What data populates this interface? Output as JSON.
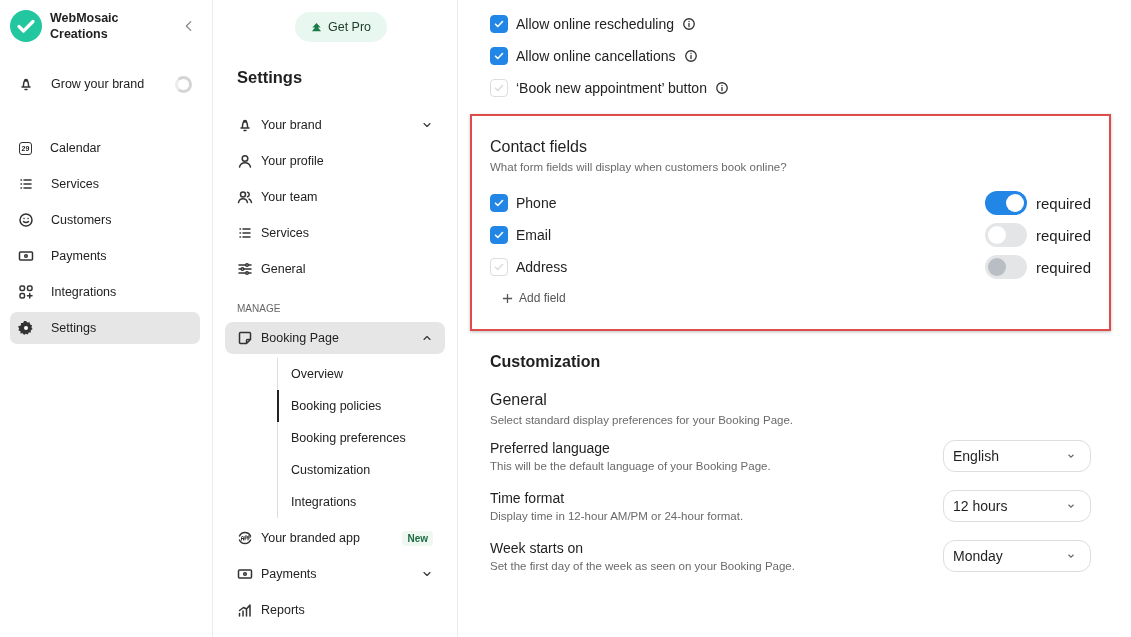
{
  "brand": {
    "name": "WebMosaic Creations"
  },
  "sidebar": {
    "promo": {
      "label": "Grow your brand"
    },
    "items": [
      {
        "label": "Calendar",
        "icon_text": "29",
        "selected": false
      },
      {
        "label": "Services",
        "selected": false
      },
      {
        "label": "Customers",
        "selected": false
      },
      {
        "label": "Payments",
        "selected": false
      },
      {
        "label": "Integrations",
        "selected": false
      },
      {
        "label": "Settings",
        "selected": true
      }
    ]
  },
  "settings_nav": {
    "get_pro": "Get Pro",
    "title": "Settings",
    "items": [
      {
        "label": "Your brand",
        "expanded": false
      },
      {
        "label": "Your profile"
      },
      {
        "label": "Your team"
      },
      {
        "label": "Services"
      },
      {
        "label": "General"
      }
    ],
    "section": "MANAGE",
    "manage": [
      {
        "label": "Booking Page",
        "selected": true,
        "expanded": true,
        "children": [
          {
            "label": "Overview",
            "selected": false
          },
          {
            "label": "Booking policies",
            "selected": true
          },
          {
            "label": "Booking preferences",
            "selected": false
          },
          {
            "label": "Customization",
            "selected": false
          },
          {
            "label": "Integrations",
            "selected": false
          }
        ]
      },
      {
        "label": "Your branded app",
        "badge": "New"
      },
      {
        "label": "Payments",
        "expanded": false
      },
      {
        "label": "Reports"
      }
    ]
  },
  "policies": [
    {
      "label": "Allow online rescheduling",
      "checked": true
    },
    {
      "label": "Allow online cancellations",
      "checked": true
    },
    {
      "label": "‘Book new appointment’ button",
      "checked": false
    }
  ],
  "contact_fields": {
    "title": "Contact fields",
    "subtitle": "What form fields will display when customers book online?",
    "fields": [
      {
        "label": "Phone",
        "checked": true,
        "required_label": "required",
        "required": true,
        "disabled": false
      },
      {
        "label": "Email",
        "checked": true,
        "required_label": "required",
        "required": false,
        "disabled": false
      },
      {
        "label": "Address",
        "checked": false,
        "required_label": "required",
        "required": false,
        "disabled": true
      }
    ],
    "add_field": "Add field"
  },
  "customization": {
    "title": "Customization",
    "section_title": "General",
    "section_subtitle": "Select standard display preferences for your Booking Page.",
    "settings": [
      {
        "label": "Preferred language",
        "description": "This will be the default language of your Booking Page.",
        "value": "English"
      },
      {
        "label": "Time format",
        "description": "Display time in 12-hour AM/PM or 24-hour format.",
        "value": "12 hours"
      },
      {
        "label": "Week starts on",
        "description": "Set the first day of the week as seen on your Booking Page.",
        "value": "Monday"
      }
    ]
  }
}
